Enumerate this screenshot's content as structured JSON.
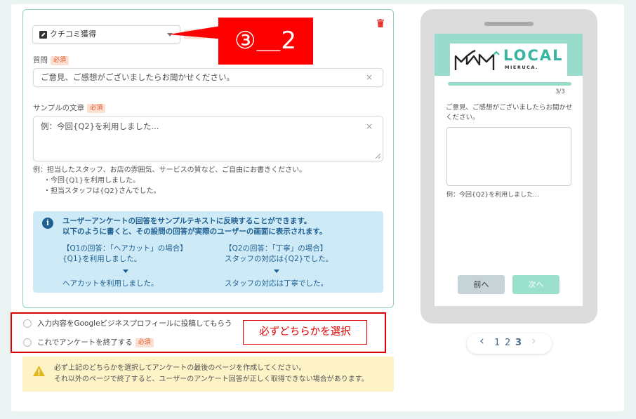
{
  "editor": {
    "question_type": "クチコミ獲得",
    "question_label": "質問",
    "required_badge": "必須",
    "question_value": "ご意見、ご感想がございましたらお聞かせください。",
    "clear_glyph": "×",
    "sample_label": "サンプルの文章",
    "sample_value": "例：今回{Q2}を利用しました...",
    "hint_lines": [
      "例：担当したスタッフ、お店の雰囲気、サービスの質など、ご自由にお書きください。",
      "・今回{Q1}を利用しました。",
      "・担当スタッフは{Q2}さんでした。"
    ]
  },
  "info": {
    "icon_glyph": "i",
    "head_line1": "ユーザーアンケートの回答をサンプルテキストに反映することができます。",
    "head_line2": "以下のように書くと、その設問の回答が実際のユーザーの画面に表示されます。",
    "left_title": "【Q1の回答：「ヘアカット」の場合】",
    "left_template": "{Q1}を利用しました。",
    "left_result": "ヘアカットを利用しました。",
    "right_title": "【Q2の回答：「丁寧」の場合】",
    "right_template": "スタッフの対応は{Q2}でした。",
    "right_result": "スタッフの対応は丁寧でした。"
  },
  "callout": {
    "label": "③＿2",
    "select_note": "必ずどちらかを選択"
  },
  "options": [
    {
      "label": "入力内容をGoogleビジネスプロフィールに投稿してもらう"
    },
    {
      "label": "これでアンケートを終了する"
    }
  ],
  "warning": {
    "line1": "必ず上記のどちらかを選択してアンケートの最後のページを作成してください。",
    "line2": "それ以外のページで終了すると、ユーザーのアンケート回答が正しく取得できない場合があります。"
  },
  "preview": {
    "logo_text": "LOCAL",
    "logo_sub": "MIERUCA.",
    "step": "3/3",
    "progress": 1.0,
    "question": "ご意見、ご感想がございましたらお聞かせください。",
    "placeholder": "例：今回{Q2}を利用しました...",
    "prev_label": "前へ",
    "next_label": "次へ"
  },
  "pager": {
    "prev_glyph": "‹",
    "next_glyph": "›",
    "pages": [
      "1",
      "2",
      "3"
    ]
  },
  "colors": {
    "accent": "#36b5a0",
    "required_text": "#e5572b",
    "callout_red": "#ff0000",
    "info_bg": "#cdeaf6",
    "info_text": "#1f5f92",
    "warning_bg": "#fdf3c7"
  }
}
